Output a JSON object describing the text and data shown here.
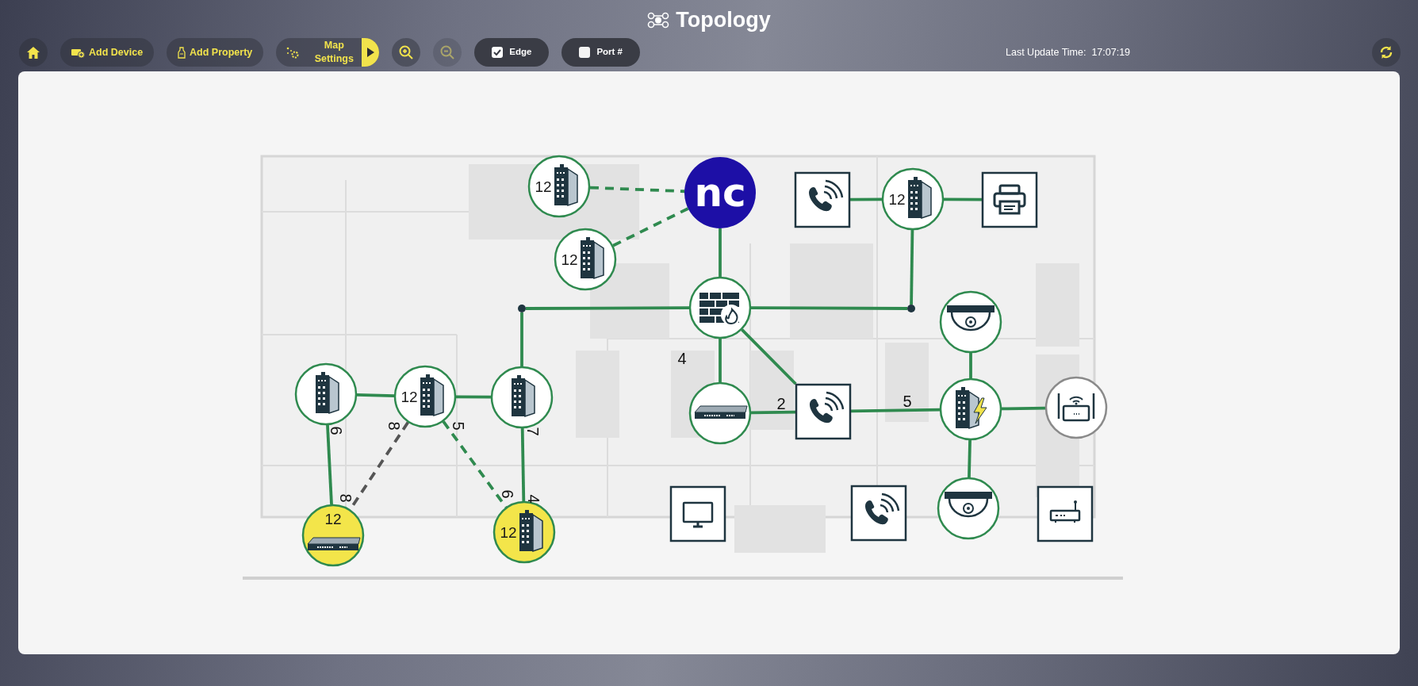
{
  "header": {
    "title": "Topology"
  },
  "toolbar": {
    "add_device": "Add Device",
    "add_property": "Add Property",
    "map_settings": "Map Settings",
    "zoom_out": {
      "disabled": true
    },
    "toggles": [
      {
        "label": "Edge",
        "checked": true
      },
      {
        "label": "Port #",
        "checked": false
      }
    ],
    "last_update": {
      "label": "Last Update Time:",
      "value": "17:07:19"
    }
  },
  "map": {
    "background": {
      "kind": "floor_plan"
    },
    "nodes": [
      {
        "kind": "building",
        "port_count": "12",
        "color": "#2f8a4f",
        "highlighted": false
      },
      {
        "kind": "building",
        "port_count": "12",
        "color": "#2f8a4f",
        "highlighted": false
      },
      {
        "kind": "nc",
        "logo_text": "nc"
      },
      {
        "kind": "phone"
      },
      {
        "kind": "building",
        "port_count": "12",
        "color": "#2f8a4f",
        "highlighted": false
      },
      {
        "kind": "printer"
      },
      {
        "kind": "firewall",
        "color": "#2f8a4f",
        "highlighted": false
      },
      {
        "kind": "junction"
      },
      {
        "kind": "junction"
      },
      {
        "kind": "camera",
        "color": "#2f8a4f",
        "highlighted": false
      },
      {
        "kind": "building",
        "color": "#2f8a4f",
        "highlighted": false
      },
      {
        "kind": "building",
        "port_count": "12",
        "color": "#2f8a4f",
        "highlighted": false
      },
      {
        "kind": "building",
        "color": "#2f8a4f",
        "highlighted": false
      },
      {
        "kind": "switch",
        "color": "#2f8a4f",
        "highlighted": false
      },
      {
        "kind": "phone"
      },
      {
        "kind": "building-power",
        "color": "#2f8a4f",
        "highlighted": false
      },
      {
        "kind": "router",
        "color": "#8a8a8a",
        "highlighted": false
      },
      {
        "kind": "switch",
        "port_count": "12",
        "color": "#2f8a4f",
        "highlighted": true
      },
      {
        "kind": "building",
        "port_count": "12",
        "color": "#2f8a4f",
        "highlighted": true
      },
      {
        "kind": "monitor"
      },
      {
        "kind": "phone"
      },
      {
        "kind": "camera",
        "color": "#2f8a4f",
        "highlighted": false
      },
      {
        "kind": "modem"
      }
    ],
    "links": [
      {
        "color": "#2f8a4f"
      },
      {
        "color": "#2f8a4f"
      },
      {
        "color": "#2f8a4f"
      },
      {
        "color": "#2f8a4f"
      },
      {
        "color": "#2f8a4f"
      },
      {
        "color": "#2f8a4f"
      },
      {
        "color": "#2f8a4f"
      },
      {
        "color": "#2f8a4f"
      },
      {
        "color": "#2f8a4f"
      },
      {
        "color": "#2f8a4f"
      },
      {
        "color": "#2f8a4f"
      },
      {
        "color": "#2f8a4f"
      },
      {
        "color": "#2f8a4f"
      },
      {
        "color": "#2f8a4f"
      },
      {
        "color": "#2f8a4f"
      },
      {
        "color": "#2f8a4f"
      },
      {
        "color": "#2f8a4f"
      },
      {
        "color": "#2f8a4f"
      },
      {
        "color": "#2f8a4f"
      },
      {
        "color": "#555555"
      },
      {
        "color": "#2f8a4f"
      },
      {
        "color": "#2f8a4f"
      }
    ],
    "port_labels": [
      "4",
      "2",
      "5",
      "6",
      "8",
      "5",
      "7",
      "8",
      "6",
      "4"
    ]
  }
}
